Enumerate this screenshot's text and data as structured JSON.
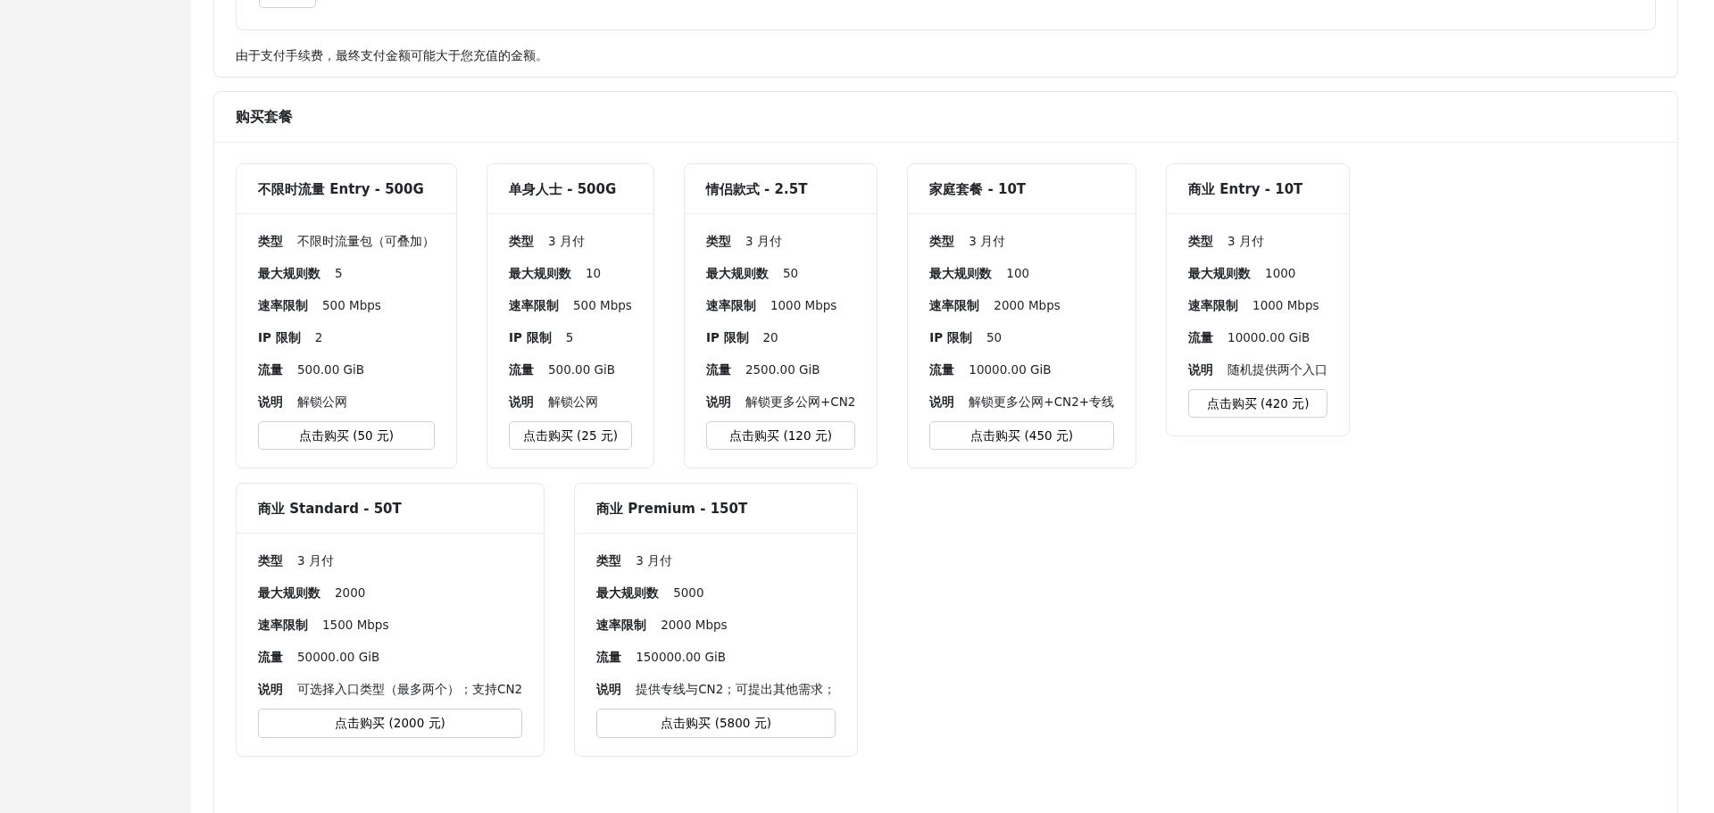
{
  "notice": "由于支付手续费，最终支付金额可能大于您充值的金额。",
  "plans_section": {
    "title": "购买套餐",
    "plans": [
      {
        "title": "不限时流量 Entry - 500G",
        "fields": [
          {
            "label": "类型",
            "value": "不限时流量包（可叠加）"
          },
          {
            "label": "最大规则数",
            "value": "5"
          },
          {
            "label": "速率限制",
            "value": "500 Mbps"
          },
          {
            "label": "IP 限制",
            "value": "2"
          },
          {
            "label": "流量",
            "value": "500.00 GiB"
          },
          {
            "label": "说明",
            "value": "解锁公网"
          }
        ],
        "buy_button": "点击购买 (50 元)"
      },
      {
        "title": "单身人士 - 500G",
        "fields": [
          {
            "label": "类型",
            "value": "3 月付"
          },
          {
            "label": "最大规则数",
            "value": "10"
          },
          {
            "label": "速率限制",
            "value": "500 Mbps"
          },
          {
            "label": "IP 限制",
            "value": "5"
          },
          {
            "label": "流量",
            "value": "500.00 GiB"
          },
          {
            "label": "说明",
            "value": "解锁公网"
          }
        ],
        "buy_button": "点击购买 (25 元)"
      },
      {
        "title": "情侣款式 - 2.5T",
        "fields": [
          {
            "label": "类型",
            "value": "3 月付"
          },
          {
            "label": "最大规则数",
            "value": "50"
          },
          {
            "label": "速率限制",
            "value": "1000 Mbps"
          },
          {
            "label": "IP 限制",
            "value": "20"
          },
          {
            "label": "流量",
            "value": "2500.00 GiB"
          },
          {
            "label": "说明",
            "value": "解锁更多公网+CN2"
          }
        ],
        "buy_button": "点击购买 (120 元)"
      },
      {
        "title": "家庭套餐 - 10T",
        "fields": [
          {
            "label": "类型",
            "value": "3 月付"
          },
          {
            "label": "最大规则数",
            "value": "100"
          },
          {
            "label": "速率限制",
            "value": "2000 Mbps"
          },
          {
            "label": "IP 限制",
            "value": "50"
          },
          {
            "label": "流量",
            "value": "10000.00 GiB"
          },
          {
            "label": "说明",
            "value": "解锁更多公网+CN2+专线"
          }
        ],
        "buy_button": "点击购买 (450 元)"
      },
      {
        "title": "商业 Entry - 10T",
        "fields": [
          {
            "label": "类型",
            "value": "3 月付"
          },
          {
            "label": "最大规则数",
            "value": "1000"
          },
          {
            "label": "速率限制",
            "value": "1000 Mbps"
          },
          {
            "label": "流量",
            "value": "10000.00 GiB"
          },
          {
            "label": "说明",
            "value": "随机提供两个入口"
          }
        ],
        "buy_button": "点击购买 (420 元)"
      },
      {
        "title": "商业 Standard - 50T",
        "fields": [
          {
            "label": "类型",
            "value": "3 月付"
          },
          {
            "label": "最大规则数",
            "value": "2000"
          },
          {
            "label": "速率限制",
            "value": "1500 Mbps"
          },
          {
            "label": "流量",
            "value": "50000.00 GiB"
          },
          {
            "label": "说明",
            "value": "可选择入口类型（最多两个）；支持CN2"
          }
        ],
        "buy_button": "点击购买 (2000 元)"
      },
      {
        "title": "商业 Premium - 150T",
        "fields": [
          {
            "label": "类型",
            "value": "3 月付"
          },
          {
            "label": "最大规则数",
            "value": "5000"
          },
          {
            "label": "速率限制",
            "value": "2000 Mbps"
          },
          {
            "label": "流量",
            "value": "150000.00 GiB"
          },
          {
            "label": "说明",
            "value": "提供专线与CN2；可提出其他需求；"
          }
        ],
        "buy_button": "点击购买 (5800 元)"
      }
    ]
  }
}
